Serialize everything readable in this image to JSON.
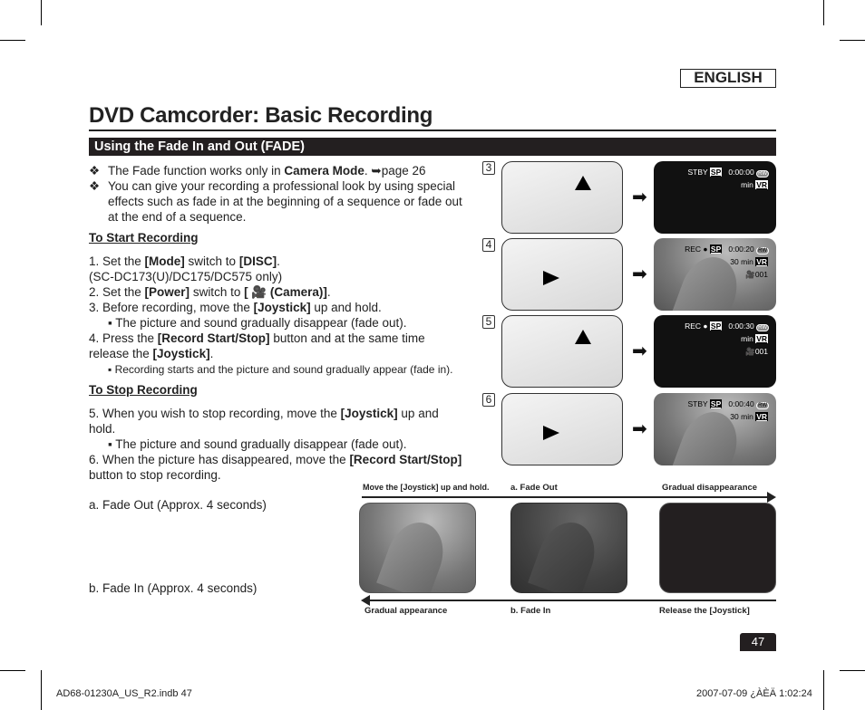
{
  "header": {
    "language": "ENGLISH",
    "title": "DVD Camcorder: Basic Recording",
    "section": "Using the Fade In and Out (FADE)"
  },
  "intro": [
    [
      {
        "t": "The Fade function works only in "
      },
      {
        "t": "Camera Mode",
        "b": 1
      },
      {
        "t": ". ➥page 26"
      }
    ],
    [
      {
        "t": "You can give your recording a professional look by using special"
      }
    ],
    [
      {
        "t": "effects such as fade in at the beginning of a sequence or fade out"
      }
    ],
    [
      {
        "t": "at the end of a sequence."
      }
    ]
  ],
  "start_heading": "To Start Recording",
  "start_steps": [
    [
      {
        "t": "1.   Set the "
      },
      {
        "t": "[Mode]",
        "b": 1
      },
      {
        "t": " switch to "
      },
      {
        "t": "[DISC]",
        "b": 1
      },
      {
        "t": "."
      }
    ],
    [
      {
        "t": "      (SC-DC173(U)/DC175/DC575 only)"
      }
    ],
    [
      {
        "t": "2.   Set the "
      },
      {
        "t": "[Power]",
        "b": 1
      },
      {
        "t": " switch to "
      },
      {
        "t": "[ 🎥 (Camera)]",
        "b": 1
      },
      {
        "t": "."
      }
    ],
    [
      {
        "t": "3.   Before recording, move the "
      },
      {
        "t": "[Joystick]",
        "b": 1
      },
      {
        "t": " up and hold."
      }
    ],
    [
      {
        "t": "▪  The picture and sound gradually disappear (fade out)."
      }
    ],
    [
      {
        "t": "4.   Press the "
      },
      {
        "t": "[Record Start/Stop]",
        "b": 1
      },
      {
        "t": " button and at the same time"
      }
    ],
    [
      {
        "t": "      release the "
      },
      {
        "t": "[Joystick]",
        "b": 1
      },
      {
        "t": "."
      }
    ],
    [
      {
        "t": "▪  Recording starts and the picture and sound gradually appear (fade in)."
      }
    ]
  ],
  "stop_heading": "To Stop Recording",
  "stop_steps": [
    [
      {
        "t": "5.   When you wish to stop recording, move the "
      },
      {
        "t": "[Joystick]",
        "b": 1
      },
      {
        "t": " up and"
      }
    ],
    [
      {
        "t": "      hold."
      }
    ],
    [
      {
        "t": "▪  The picture and sound gradually disappear (fade out)."
      }
    ],
    [
      {
        "t": "6.   When the picture has disappeared, move the "
      },
      {
        "t": "[Record Start/Stop]",
        "b": 1
      }
    ],
    [
      {
        "t": "      button to stop recording."
      }
    ],
    [
      {
        "t": "      a. Fade Out (Approx. 4 seconds)"
      }
    ],
    [
      {
        "t": "      b. Fade In (Approx. 4 seconds)"
      }
    ]
  ],
  "steps_panel": [
    {
      "num": "3",
      "status": "STBY",
      "mode": "SP",
      "time": "0:00:00",
      "disc": "RW",
      "remain": "min",
      "fmt": "VR",
      "counter": "",
      "dolphin": false
    },
    {
      "num": "4",
      "status": "REC ●",
      "mode": "SP",
      "time": "0:00:20",
      "disc": "RW",
      "remain": "30 min",
      "fmt": "VR",
      "counter": "001",
      "dolphin": true
    },
    {
      "num": "5",
      "status": "REC ●",
      "mode": "SP",
      "time": "0:00:30",
      "disc": "RW",
      "remain": "min",
      "fmt": "VR",
      "counter": "001",
      "dolphin": false
    },
    {
      "num": "6",
      "status": "STBY",
      "mode": "SP",
      "time": "0:00:40",
      "disc": "RW",
      "remain": "30 min",
      "fmt": "VR",
      "counter": "",
      "dolphin": true
    }
  ],
  "fade_diagram": {
    "top_left": "Move the [Joystick] up and hold.",
    "top_mid": "a. Fade Out",
    "top_right": "Gradual disappearance",
    "bottom_left": "Gradual appearance",
    "bottom_mid": "b. Fade In",
    "bottom_right": "Release the [Joystick]"
  },
  "page_number": "47",
  "footer": {
    "left": "AD68-01230A_US_R2.indb   47",
    "right": "2007-07-09   ¿ÀÈÄ 1:02:24"
  }
}
